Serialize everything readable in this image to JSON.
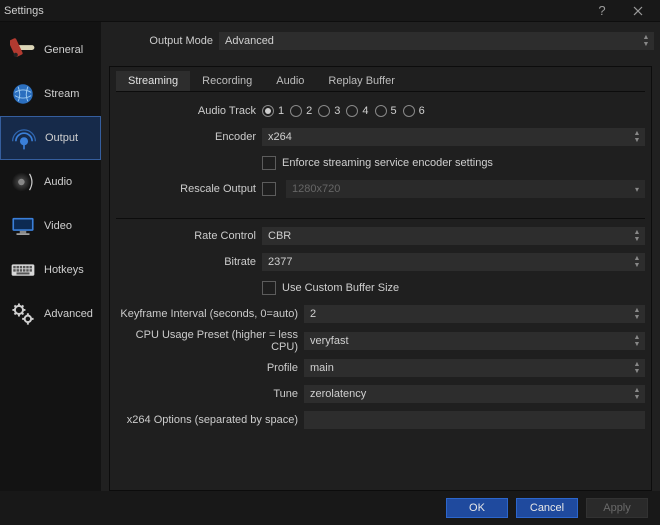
{
  "window": {
    "title": "Settings"
  },
  "sidebar": {
    "items": [
      {
        "label": "General"
      },
      {
        "label": "Stream"
      },
      {
        "label": "Output"
      },
      {
        "label": "Audio"
      },
      {
        "label": "Video"
      },
      {
        "label": "Hotkeys"
      },
      {
        "label": "Advanced"
      }
    ],
    "selected_index": 2
  },
  "main": {
    "output_mode_label": "Output Mode",
    "output_mode_value": "Advanced",
    "tabs": [
      {
        "label": "Streaming"
      },
      {
        "label": "Recording"
      },
      {
        "label": "Audio"
      },
      {
        "label": "Replay Buffer"
      }
    ],
    "active_tab": 0,
    "audio_track_label": "Audio Track",
    "audio_track_options": [
      "1",
      "2",
      "3",
      "4",
      "5",
      "6"
    ],
    "audio_track_selected": 0,
    "encoder_label": "Encoder",
    "encoder_value": "x264",
    "enforce_label": "Enforce streaming service encoder settings",
    "rescale_label": "Rescale Output",
    "rescale_value": "1280x720",
    "rate_control_label": "Rate Control",
    "rate_control_value": "CBR",
    "bitrate_label": "Bitrate",
    "bitrate_value": "2377",
    "use_custom_buf_label": "Use Custom Buffer Size",
    "keyframe_label": "Keyframe Interval (seconds, 0=auto)",
    "keyframe_value": "2",
    "cpu_preset_label": "CPU Usage Preset (higher = less CPU)",
    "cpu_preset_value": "veryfast",
    "profile_label": "Profile",
    "profile_value": "main",
    "tune_label": "Tune",
    "tune_value": "zerolatency",
    "x264opts_label": "x264 Options (separated by space)",
    "x264opts_value": ""
  },
  "footer": {
    "ok": "OK",
    "cancel": "Cancel",
    "apply": "Apply"
  }
}
